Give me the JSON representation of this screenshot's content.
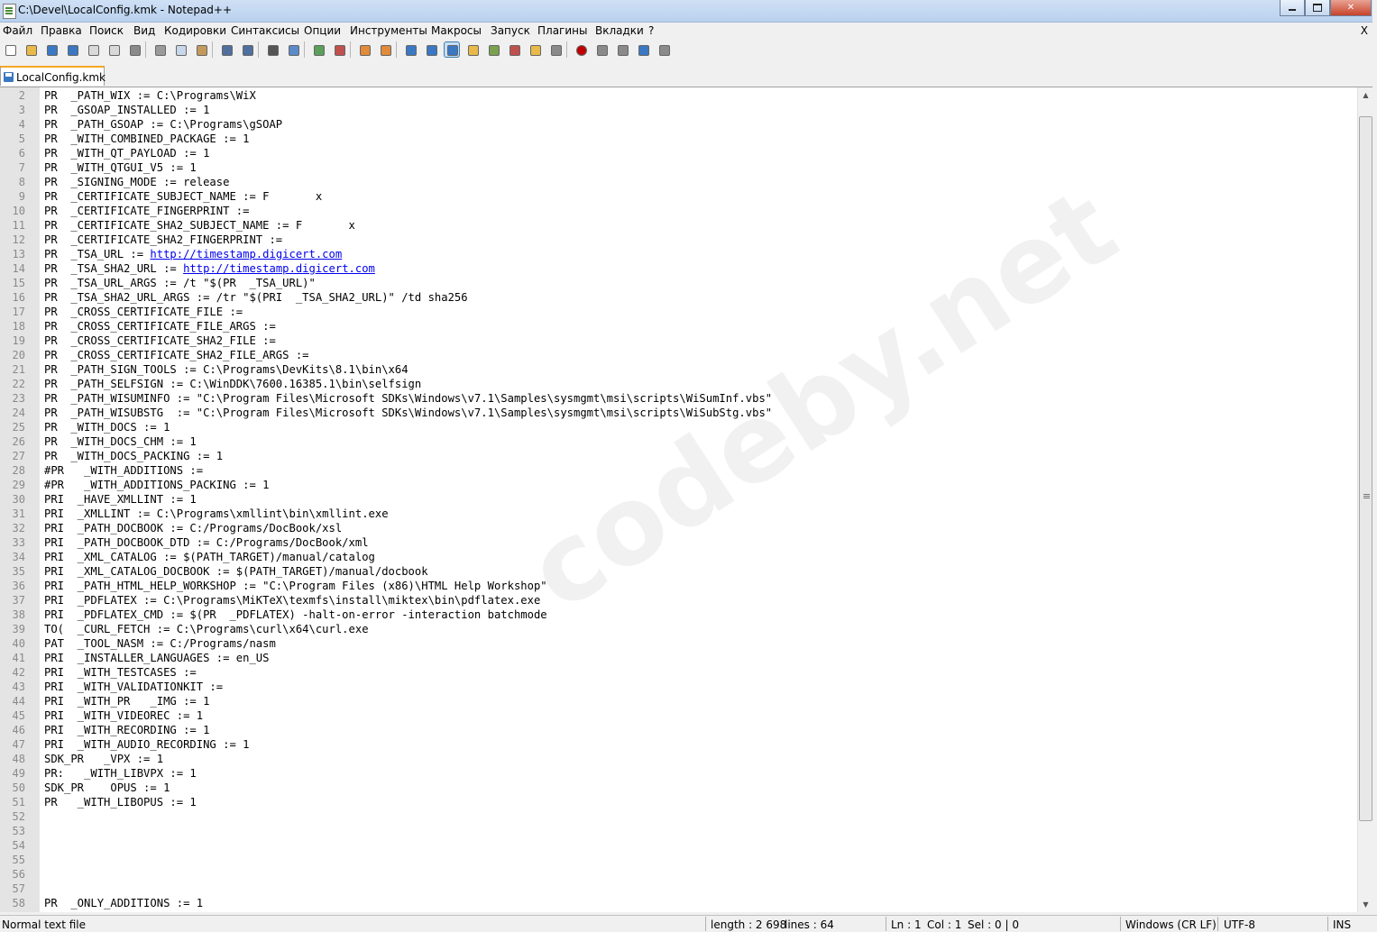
{
  "window": {
    "title": "C:\\Devel\\LocalConfig.kmk - Notepad++",
    "controls": {
      "close": "✕"
    }
  },
  "menu": {
    "items": [
      "Файл",
      "Правка",
      "Поиск",
      "Вид",
      "Кодировки",
      "Синтаксисы",
      "Опции",
      "Инструменты",
      "Макросы",
      "Запуск",
      "Плагины",
      "Вкладки",
      "?"
    ],
    "close_doc": "X"
  },
  "toolbar": {
    "icons": [
      "new-file-icon",
      "open-file-icon",
      "save-icon",
      "save-all-icon",
      "close-icon",
      "close-all-icon",
      "print-icon",
      "cut-icon",
      "copy-icon",
      "paste-icon",
      "undo-icon",
      "redo-icon",
      "find-icon",
      "replace-icon",
      "zoom-in-icon",
      "zoom-out-icon",
      "sync-vertical-icon",
      "sync-horizontal-icon",
      "word-wrap-icon",
      "show-all-chars-icon",
      "indent-guide-icon",
      "language-icon",
      "document-map-icon",
      "function-list-icon",
      "folder-workspace-icon",
      "monitoring-icon",
      "record-macro-icon",
      "stop-macro-icon",
      "play-macro-icon",
      "run-macro-multiple-icon",
      "save-macro-icon"
    ]
  },
  "tab": {
    "label": "LocalConfig.kmk"
  },
  "editor": {
    "lines": [
      {
        "n": "2",
        "t": "PR  _PATH_WIX := C:\\Programs\\WiX"
      },
      {
        "n": "3",
        "t": "PR  _GSOAP_INSTALLED := 1"
      },
      {
        "n": "4",
        "t": "PR  _PATH_GSOAP := C:\\Programs\\gSOAP"
      },
      {
        "n": "5",
        "t": "PR  _WITH_COMBINED_PACKAGE := 1"
      },
      {
        "n": "6",
        "t": "PR  _WITH_QT_PAYLOAD := 1"
      },
      {
        "n": "7",
        "t": "PR  _WITH_QTGUI_V5 := 1"
      },
      {
        "n": "8",
        "t": "PR  _SIGNING_MODE := release"
      },
      {
        "n": "9",
        "t": "PR  _CERTIFICATE_SUBJECT_NAME := F       x"
      },
      {
        "n": "10",
        "t": "PR  _CERTIFICATE_FINGERPRINT := "
      },
      {
        "n": "11",
        "t": "PR  _CERTIFICATE_SHA2_SUBJECT_NAME := F       x"
      },
      {
        "n": "12",
        "t": "PR  _CERTIFICATE_SHA2_FINGERPRINT := "
      },
      {
        "n": "13",
        "t": "PR  _TSA_URL := ",
        "link": "http://timestamp.digicert.com"
      },
      {
        "n": "14",
        "t": "PR  _TSA_SHA2_URL := ",
        "link": "http://timestamp.digicert.com"
      },
      {
        "n": "15",
        "t": "PR  _TSA_URL_ARGS := /t \"$(PR  _TSA_URL)\""
      },
      {
        "n": "16",
        "t": "PR  _TSA_SHA2_URL_ARGS := /tr \"$(PRI  _TSA_SHA2_URL)\" /td sha256"
      },
      {
        "n": "17",
        "t": "PR  _CROSS_CERTIFICATE_FILE :="
      },
      {
        "n": "18",
        "t": "PR  _CROSS_CERTIFICATE_FILE_ARGS :="
      },
      {
        "n": "19",
        "t": "PR  _CROSS_CERTIFICATE_SHA2_FILE :="
      },
      {
        "n": "20",
        "t": "PR  _CROSS_CERTIFICATE_SHA2_FILE_ARGS :="
      },
      {
        "n": "21",
        "t": "PR  _PATH_SIGN_TOOLS := C:\\Programs\\DevKits\\8.1\\bin\\x64"
      },
      {
        "n": "22",
        "t": "PR  _PATH_SELFSIGN := C:\\WinDDK\\7600.16385.1\\bin\\selfsign"
      },
      {
        "n": "23",
        "t": "PR  _PATH_WISUMINFO := \"C:\\Program Files\\Microsoft SDKs\\Windows\\v7.1\\Samples\\sysmgmt\\msi\\scripts\\WiSumInf.vbs\""
      },
      {
        "n": "24",
        "t": "PR  _PATH_WISUBSTG  := \"C:\\Program Files\\Microsoft SDKs\\Windows\\v7.1\\Samples\\sysmgmt\\msi\\scripts\\WiSubStg.vbs\""
      },
      {
        "n": "25",
        "t": "PR  _WITH_DOCS := 1"
      },
      {
        "n": "26",
        "t": "PR  _WITH_DOCS_CHM := 1"
      },
      {
        "n": "27",
        "t": "PR  _WITH_DOCS_PACKING := 1"
      },
      {
        "n": "28",
        "t": "#PR   _WITH_ADDITIONS :="
      },
      {
        "n": "29",
        "t": "#PR   _WITH_ADDITIONS_PACKING := 1"
      },
      {
        "n": "30",
        "t": "PRI  _HAVE_XMLLINT := 1"
      },
      {
        "n": "31",
        "t": "PRI  _XMLLINT := C:\\Programs\\xmllint\\bin\\xmllint.exe"
      },
      {
        "n": "32",
        "t": "PRI  _PATH_DOCBOOK := C:/Programs/DocBook/xsl"
      },
      {
        "n": "33",
        "t": "PRI  _PATH_DOCBOOK_DTD := C:/Programs/DocBook/xml"
      },
      {
        "n": "34",
        "t": "PRI  _XML_CATALOG := $(PATH_TARGET)/manual/catalog"
      },
      {
        "n": "35",
        "t": "PRI  _XML_CATALOG_DOCBOOK := $(PATH_TARGET)/manual/docbook"
      },
      {
        "n": "36",
        "t": "PRI  _PATH_HTML_HELP_WORKSHOP := \"C:\\Program Files (x86)\\HTML Help Workshop\""
      },
      {
        "n": "37",
        "t": "PRI  _PDFLATEX := C:\\Programs\\MiKTeX\\texmfs\\install\\miktex\\bin\\pdflatex.exe"
      },
      {
        "n": "38",
        "t": "PRI  _PDFLATEX_CMD := $(PR  _PDFLATEX) -halt-on-error -interaction batchmode"
      },
      {
        "n": "39",
        "t": "TO(  _CURL_FETCH := C:\\Programs\\curl\\x64\\curl.exe"
      },
      {
        "n": "40",
        "t": "PAT  _TOOL_NASM := C:/Programs/nasm"
      },
      {
        "n": "41",
        "t": "PRI  _INSTALLER_LANGUAGES := en_US"
      },
      {
        "n": "42",
        "t": "PRI  _WITH_TESTCASES :="
      },
      {
        "n": "43",
        "t": "PRI  _WITH_VALIDATIONKIT :="
      },
      {
        "n": "44",
        "t": "PRI  _WITH_PR   _IMG := 1"
      },
      {
        "n": "45",
        "t": "PRI  _WITH_VIDEOREC := 1"
      },
      {
        "n": "46",
        "t": "PRI  _WITH_RECORDING := 1"
      },
      {
        "n": "47",
        "t": "PRI  _WITH_AUDIO_RECORDING := 1"
      },
      {
        "n": "48",
        "t": "SDK_PR   _VPX := 1"
      },
      {
        "n": "49",
        "t": "PR:   _WITH_LIBVPX := 1"
      },
      {
        "n": "50",
        "t": "SDK_PR    OPUS := 1"
      },
      {
        "n": "51",
        "t": "PR   _WITH_LIBOPUS := 1"
      },
      {
        "n": "52",
        "t": ""
      },
      {
        "n": "53",
        "t": ""
      },
      {
        "n": "54",
        "t": ""
      },
      {
        "n": "55",
        "t": ""
      },
      {
        "n": "56",
        "t": ""
      },
      {
        "n": "57",
        "t": ""
      },
      {
        "n": "58",
        "t": "PR  _ONLY_ADDITIONS := 1"
      }
    ]
  },
  "watermark": "codeby.net",
  "status": {
    "file_type": "Normal text file",
    "length": "length : 2 698",
    "lines": "lines : 64",
    "ln": "Ln : 1",
    "col": "Col : 1",
    "sel": "Sel : 0 | 0",
    "eol": "Windows (CR LF)",
    "encoding": "UTF-8",
    "mode": "INS"
  },
  "colors": {
    "gutter": "#e4e4e4",
    "link": "#0000ee",
    "tab_accent": "#f5a623"
  }
}
